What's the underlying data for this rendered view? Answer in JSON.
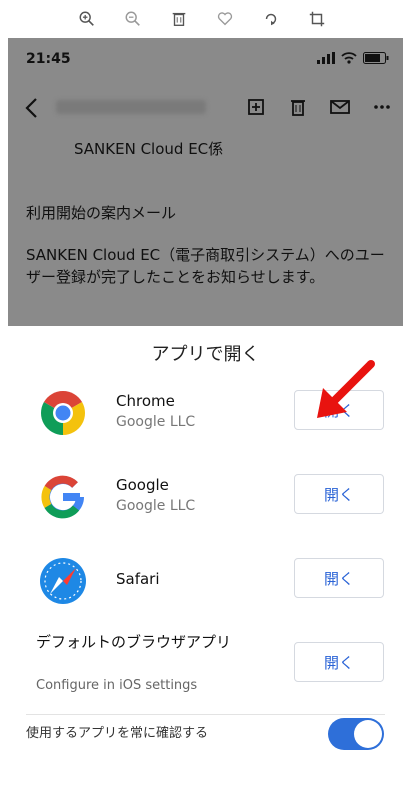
{
  "toolbar": {
    "icons": [
      "zoom-in-icon",
      "zoom-out-icon",
      "trash-icon",
      "heart-icon",
      "rotate-icon",
      "crop-icon"
    ]
  },
  "status_bar": {
    "time": "21:45"
  },
  "mail": {
    "recipient": "SANKEN Cloud EC係",
    "heading": "利用開始の案内メール",
    "body": "SANKEN Cloud EC（電子商取引システム）へのユーザー登録が完了したことをお知らせします。"
  },
  "sheet": {
    "title": "アプリで開く",
    "apps": [
      {
        "name": "Chrome",
        "developer": "Google LLC",
        "button": "開く"
      },
      {
        "name": "Google",
        "developer": "Google LLC",
        "button": "開く"
      },
      {
        "name": "Safari",
        "developer": "",
        "button": "開く"
      }
    ],
    "default_browser": {
      "name": "デフォルトのブラウザアプリ",
      "subtitle": "Configure in iOS settings",
      "button": "開く"
    },
    "always_ask": {
      "label": "使用するアプリを常に確認する",
      "enabled": true
    },
    "accent_color": "#2e6fd9"
  }
}
